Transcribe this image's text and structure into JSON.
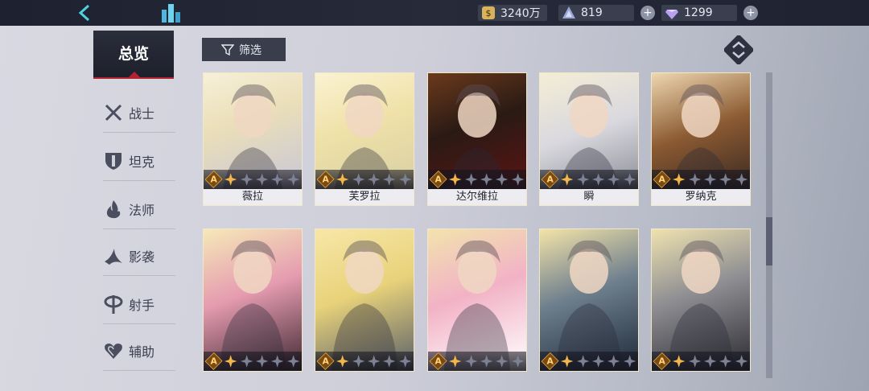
{
  "topbar": {
    "gold": "3240万",
    "crystal": "819",
    "gem": "1299",
    "plus_label": "+"
  },
  "sidebar": {
    "overview_label": "总览",
    "items": [
      {
        "label": "战士",
        "icon": "crossed-swords-icon"
      },
      {
        "label": "坦克",
        "icon": "shield-icon"
      },
      {
        "label": "法师",
        "icon": "flame-icon"
      },
      {
        "label": "影袭",
        "icon": "shadow-blade-icon"
      },
      {
        "label": "射手",
        "icon": "crosshair-icon"
      },
      {
        "label": "辅助",
        "icon": "heart-icon"
      }
    ]
  },
  "filter": {
    "label": "筛选"
  },
  "colors": {
    "accent": "#b4232f",
    "rank_gold": "#e9b34b"
  },
  "heroes": [
    {
      "name": "薇拉",
      "rank": "A"
    },
    {
      "name": "芙罗拉",
      "rank": "A"
    },
    {
      "name": "达尔维拉",
      "rank": "A"
    },
    {
      "name": "瞬",
      "rank": "A"
    },
    {
      "name": "罗纳克",
      "rank": "A"
    },
    {
      "name": "",
      "rank": "A"
    },
    {
      "name": "",
      "rank": "A"
    },
    {
      "name": "",
      "rank": "A"
    },
    {
      "name": "",
      "rank": "A"
    },
    {
      "name": "",
      "rank": "A"
    }
  ]
}
